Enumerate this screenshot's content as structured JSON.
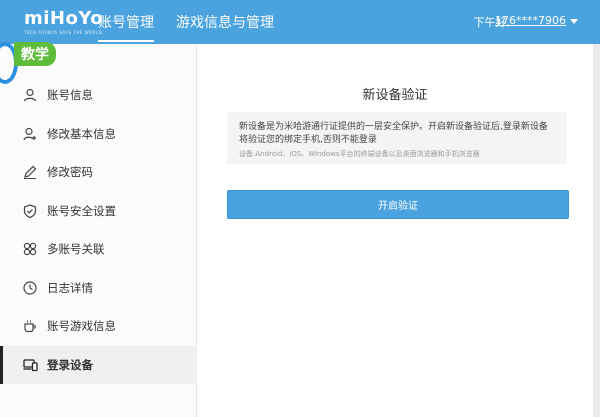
{
  "header": {
    "logo": "miHoYo",
    "logo_tagline": "TECH OTAKUS SAVE THE WORLD",
    "nav": [
      {
        "label": "账号管理"
      },
      {
        "label": "游戏信息与管理"
      }
    ],
    "greeting": "下午好,",
    "user": "176****7906",
    "colors": {
      "bar": "#4aa3df"
    }
  },
  "badge": {
    "label": "教学"
  },
  "sidebar": {
    "items": [
      {
        "label": "账号信息",
        "icon": "person-icon"
      },
      {
        "label": "修改基本信息",
        "icon": "person-edit-icon"
      },
      {
        "label": "修改密码",
        "icon": "pencil-icon"
      },
      {
        "label": "账号安全设置",
        "icon": "shield-icon"
      },
      {
        "label": "多账号关联",
        "icon": "link-grid-icon"
      },
      {
        "label": "日志详情",
        "icon": "clock-icon"
      },
      {
        "label": "账号游戏信息",
        "icon": "cup-icon"
      },
      {
        "label": "登录设备",
        "icon": "devices-icon"
      }
    ],
    "active_index": 7
  },
  "panel": {
    "title": "新设备验证",
    "info_main": "新设备是为米哈游通行证提供的一层安全保护。开启新设备验证后,登录新设备将验证您的绑定手机,否则不能登录",
    "info_sub": "设备:Android、iOS、Windows平台的终端设备以及桌面浏览器和手机浏览器",
    "button": "开启验证"
  }
}
